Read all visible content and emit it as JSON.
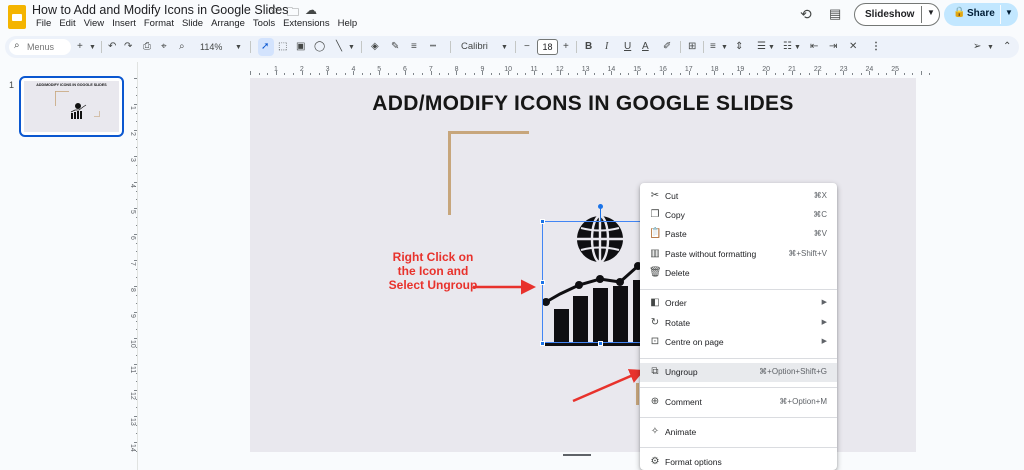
{
  "app": {
    "doc_title": "How to Add and Modify Icons in Google Slides",
    "menu": [
      "File",
      "Edit",
      "View",
      "Insert",
      "Format",
      "Slide",
      "Arrange",
      "Tools",
      "Extensions",
      "Help"
    ],
    "slideshow_label": "Slideshow",
    "share_label": "Share"
  },
  "toolbar": {
    "menus_placeholder": "Menus",
    "zoom": "114%",
    "font": "Calibri",
    "font_size": "18"
  },
  "ruler": {
    "h_labels": [
      "1",
      "2",
      "3",
      "4",
      "5",
      "6",
      "7",
      "8",
      "9",
      "10",
      "11",
      "12",
      "13",
      "14",
      "15",
      "16",
      "17",
      "18",
      "19",
      "20",
      "21",
      "22",
      "23",
      "24",
      "25"
    ],
    "v_labels": [
      "1",
      "2",
      "3",
      "4",
      "5",
      "6",
      "7",
      "8",
      "9",
      "10",
      "11",
      "12",
      "13",
      "14"
    ]
  },
  "filmstrip": {
    "slide_number": "1",
    "thumb_title": "ADD/MODIFY ICONS IN GOOGLE SLIDES"
  },
  "slide": {
    "title": "ADD/MODIFY ICONS IN GOOGLE SLIDES",
    "instruction": "Right Click on the Icon and Select Ungroup"
  },
  "context_menu": {
    "items": [
      {
        "label": "Cut",
        "shortcut": "⌘X",
        "icon": "scissors-icon"
      },
      {
        "label": "Copy",
        "shortcut": "⌘C",
        "icon": "copy-icon"
      },
      {
        "label": "Paste",
        "shortcut": "⌘V",
        "icon": "paste-icon"
      },
      {
        "label": "Paste without formatting",
        "shortcut": "⌘+Shift+V",
        "icon": "paste-plain-icon"
      },
      {
        "label": "Delete",
        "shortcut": "",
        "icon": "trash-icon"
      },
      {
        "label": "Order",
        "shortcut": "",
        "icon": "order-icon"
      },
      {
        "label": "Rotate",
        "shortcut": "",
        "icon": "rotate-icon"
      },
      {
        "label": "Centre on page",
        "shortcut": "",
        "icon": "center-icon"
      },
      {
        "label": "Ungroup",
        "shortcut": "⌘+Option+Shift+G",
        "icon": "ungroup-icon"
      },
      {
        "label": "Comment",
        "shortcut": "⌘+Option+M",
        "icon": "comment-icon"
      },
      {
        "label": "Animate",
        "shortcut": "",
        "icon": "animate-icon"
      },
      {
        "label": "Format options",
        "shortcut": "",
        "icon": "format-options-icon"
      }
    ]
  },
  "colors": {
    "accent_blue": "#0b57d0",
    "share_bg": "#c2e7ff",
    "annotation_red": "#e8322c",
    "gold_line": "#c7a67c",
    "slide_bg": "#e9e8ee"
  }
}
